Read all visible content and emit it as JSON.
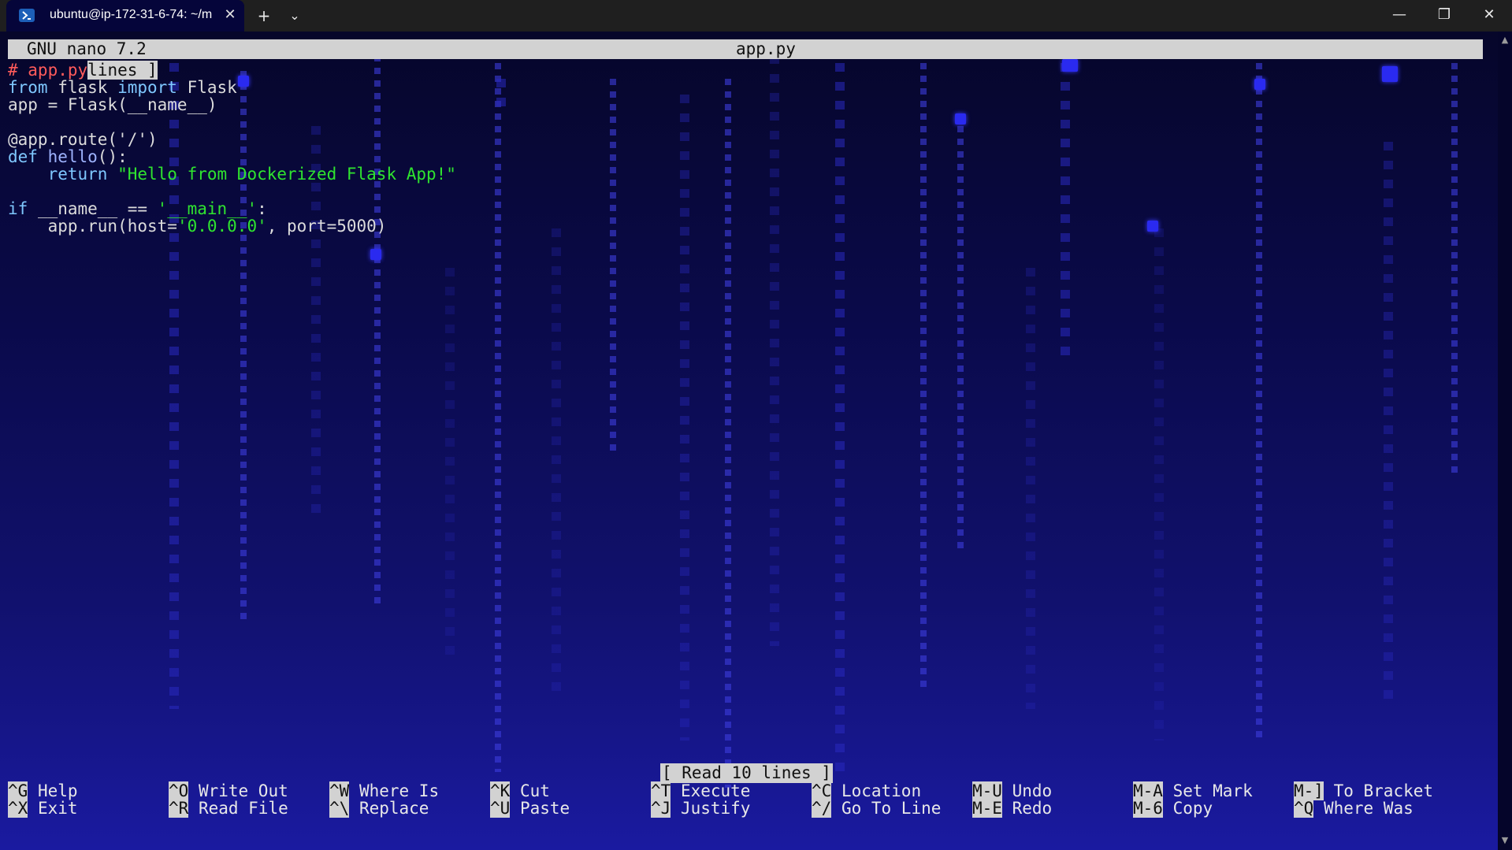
{
  "window": {
    "tab_title": "ubuntu@ip-172-31-6-74: ~/m",
    "tab_close": "✕",
    "new_tab": "+",
    "tab_dropdown": "⌄",
    "minimize": "—",
    "maximize": "❐",
    "close": "✕"
  },
  "nano": {
    "version": "GNU nano 7.2",
    "filename": "app.py",
    "status_message": "[ Read 10 lines ]"
  },
  "code": {
    "l1_comment": "# app.py",
    "l1_overlay": "lines ]",
    "l2_from": "from",
    "l2_mid": " flask ",
    "l2_import": "import",
    "l2_end": " Flask",
    "l3": "app = Flask(__name__)",
    "l5": "@app.route('/')",
    "l6_def": "def",
    "l6_fn": " hello",
    "l6_end": "():",
    "l7_indent": "    ",
    "l7_return": "return",
    "l7_str": " \"Hello from Dockerized Flask App!\"",
    "l9_if": "if",
    "l9_mid": " __name__ == ",
    "l9_str": "'__main__'",
    "l9_end": ":",
    "l10_a": "    app.run(host=",
    "l10_str": "'0.0.0.0'",
    "l10_b": ", port=5000)"
  },
  "shortcuts": [
    {
      "key": "^G",
      "label": " Help"
    },
    {
      "key": "^X",
      "label": " Exit"
    },
    {
      "key": "^O",
      "label": " Write Out"
    },
    {
      "key": "^R",
      "label": " Read File"
    },
    {
      "key": "^W",
      "label": " Where Is"
    },
    {
      "key": "^\\",
      "label": " Replace"
    },
    {
      "key": "^K",
      "label": " Cut"
    },
    {
      "key": "^U",
      "label": " Paste"
    },
    {
      "key": "^T",
      "label": " Execute"
    },
    {
      "key": "^J",
      "label": " Justify"
    },
    {
      "key": "^C",
      "label": " Location"
    },
    {
      "key": "^/",
      "label": " Go To Line"
    },
    {
      "key": "M-U",
      "label": " Undo"
    },
    {
      "key": "M-E",
      "label": " Redo"
    },
    {
      "key": "M-A",
      "label": " Set Mark"
    },
    {
      "key": "M-6",
      "label": " Copy"
    },
    {
      "key": "M-]",
      "label": " To Bracket"
    },
    {
      "key": "^Q",
      "label": " Where Was"
    }
  ],
  "scrollbar": {
    "up": "▲",
    "down": "▼"
  }
}
